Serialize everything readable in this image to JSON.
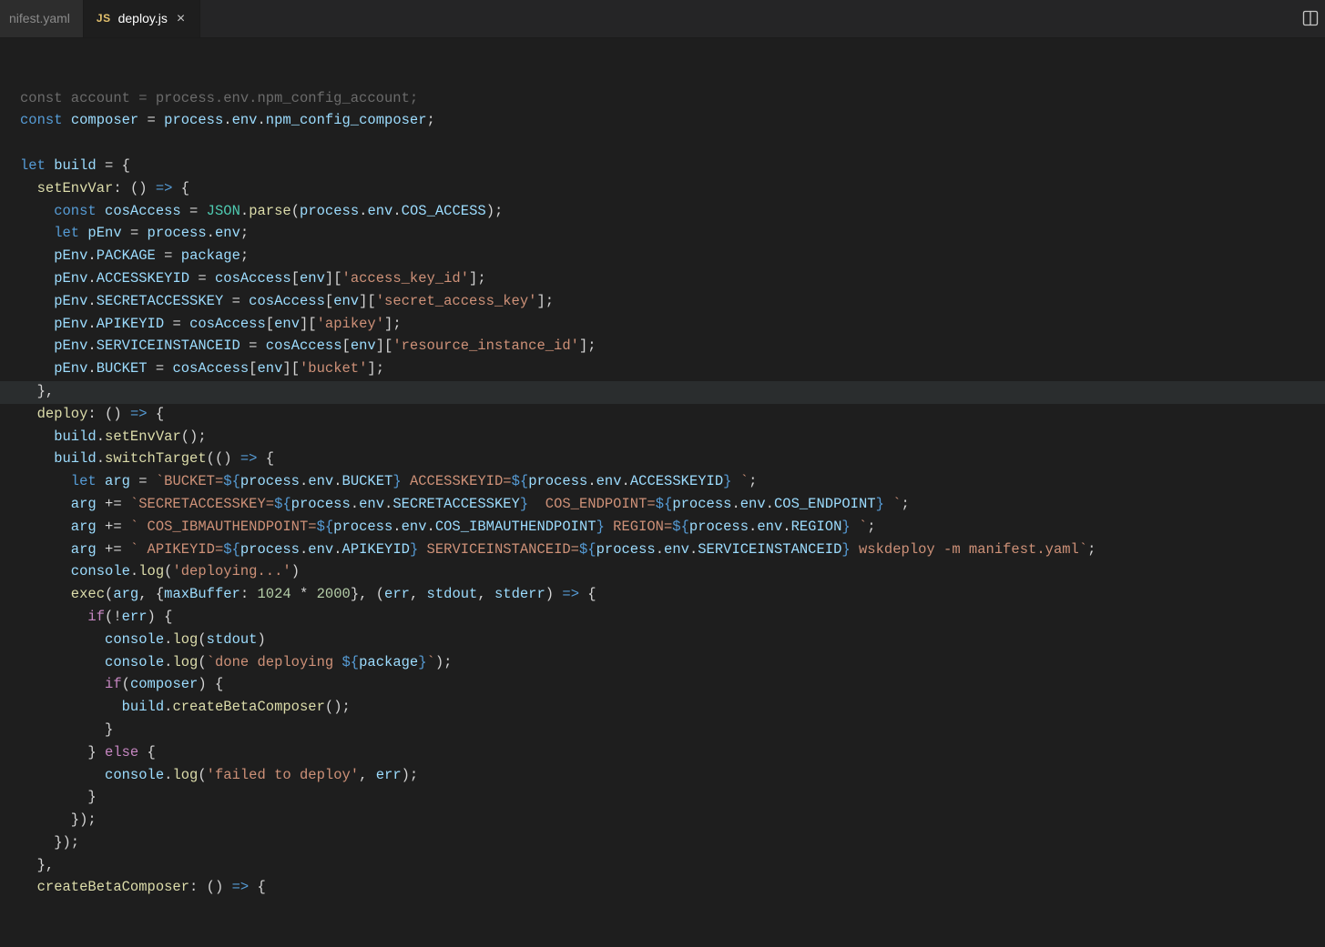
{
  "tabs": {
    "left": {
      "label": "nifest.yaml"
    },
    "active": {
      "icon": "JS",
      "label": "deploy.js"
    }
  },
  "code": {
    "l00": "const account = process.env.npm_config_account;",
    "l01a": "const",
    "l01b": " composer ",
    "l01c": "=",
    "l01d": " process",
    "l01e": ".",
    "l01f": "env",
    "l01g": ".",
    "l01h": "npm_config_composer",
    "l01i": ";",
    "l03a": "let",
    "l03b": " build ",
    "l03c": "=",
    "l03d": " {",
    "l04a": "  setEnvVar",
    "l04b": ":",
    "l04c": " () ",
    "l04d": "=>",
    "l04e": " {",
    "l05a": "    const",
    "l05b": " cosAccess ",
    "l05c": "=",
    "l05d": " JSON",
    "l05e": ".",
    "l05f": "parse",
    "l05g": "(",
    "l05h": "process",
    "l05i": ".",
    "l05j": "env",
    "l05k": ".",
    "l05l": "COS_ACCESS",
    "l05m": ");",
    "l06a": "    let",
    "l06b": " pEnv ",
    "l06c": "=",
    "l06d": " process",
    "l06e": ".",
    "l06f": "env",
    "l06g": ";",
    "l07a": "    pEnv",
    "l07b": ".",
    "l07c": "PACKAGE",
    "l07d": " = ",
    "l07e": "package",
    "l07f": ";",
    "l08a": "    pEnv",
    "l08b": ".",
    "l08c": "ACCESSKEYID",
    "l08d": " = ",
    "l08e": "cosAccess",
    "l08f": "[",
    "l08g": "env",
    "l08h": "][",
    "l08i": "'access_key_id'",
    "l08j": "];",
    "l09a": "    pEnv",
    "l09b": ".",
    "l09c": "SECRETACCESSKEY",
    "l09d": " = ",
    "l09e": "cosAccess",
    "l09f": "[",
    "l09g": "env",
    "l09h": "][",
    "l09i": "'secret_access_key'",
    "l09j": "];",
    "l10a": "    pEnv",
    "l10b": ".",
    "l10c": "APIKEYID",
    "l10d": " = ",
    "l10e": "cosAccess",
    "l10f": "[",
    "l10g": "env",
    "l10h": "][",
    "l10i": "'apikey'",
    "l10j": "];",
    "l11a": "    pEnv",
    "l11b": ".",
    "l11c": "SERVICEINSTANCEID",
    "l11d": " = ",
    "l11e": "cosAccess",
    "l11f": "[",
    "l11g": "env",
    "l11h": "][",
    "l11i": "'resource_instance_id'",
    "l11j": "];",
    "l12a": "    pEnv",
    "l12b": ".",
    "l12c": "BUCKET",
    "l12d": " = ",
    "l12e": "cosAccess",
    "l12f": "[",
    "l12g": "env",
    "l12h": "][",
    "l12i": "'bucket'",
    "l12j": "];",
    "l13": "  },",
    "l14a": "  deploy",
    "l14b": ":",
    "l14c": " () ",
    "l14d": "=>",
    "l14e": " {",
    "l15a": "    build",
    "l15b": ".",
    "l15c": "setEnvVar",
    "l15d": "();",
    "l16a": "    build",
    "l16b": ".",
    "l16c": "switchTarget",
    "l16d": "(() ",
    "l16e": "=>",
    "l16f": " {",
    "l17a": "      let",
    "l17b": " arg ",
    "l17c": "=",
    "l17d": " `BUCKET=",
    "l17e": "${",
    "l17f": "process",
    "l17g": ".",
    "l17h": "env",
    "l17i": ".",
    "l17j": "BUCKET",
    "l17k": "}",
    "l17l": " ACCESSKEYID=",
    "l17m": "${",
    "l17n": "process",
    "l17o": ".",
    "l17p": "env",
    "l17q": ".",
    "l17r": "ACCESSKEYID",
    "l17s": "}",
    "l17t": " `",
    "l17u": ";",
    "l18a": "      arg ",
    "l18b": "+=",
    "l18c": " `SECRETACCESSKEY=",
    "l18d": "${",
    "l18e": "process",
    "l18f": ".",
    "l18g": "env",
    "l18h": ".",
    "l18i": "SECRETACCESSKEY",
    "l18j": "}",
    "l18k": "  COS_ENDPOINT=",
    "l18l": "${",
    "l18m": "process",
    "l18n": ".",
    "l18o": "env",
    "l18p": ".",
    "l18q": "COS_ENDPOINT",
    "l18r": "}",
    "l18s": " `",
    "l18t": ";",
    "l19a": "      arg ",
    "l19b": "+=",
    "l19c": " ` COS_IBMAUTHENDPOINT=",
    "l19d": "${",
    "l19e": "process",
    "l19f": ".",
    "l19g": "env",
    "l19h": ".",
    "l19i": "COS_IBMAUTHENDPOINT",
    "l19j": "}",
    "l19k": " REGION=",
    "l19l": "${",
    "l19m": "process",
    "l19n": ".",
    "l19o": "env",
    "l19p": ".",
    "l19q": "REGION",
    "l19r": "}",
    "l19s": " `",
    "l19t": ";",
    "l20a": "      arg ",
    "l20b": "+=",
    "l20c": " ` APIKEYID=",
    "l20d": "${",
    "l20e": "process",
    "l20f": ".",
    "l20g": "env",
    "l20h": ".",
    "l20i": "APIKEYID",
    "l20j": "}",
    "l20k": " SERVICEINSTANCEID=",
    "l20l": "${",
    "l20m": "process",
    "l20n": ".",
    "l20o": "env",
    "l20p": ".",
    "l20q": "SERVICEINSTANCEID",
    "l20r": "}",
    "l20s": " wskdeploy -m manifest.yaml`",
    "l20t": ";",
    "l21a": "      console",
    "l21b": ".",
    "l21c": "log",
    "l21d": "(",
    "l21e": "'deploying...'",
    "l21f": ")",
    "l22a": "      exec",
    "l22b": "(",
    "l22c": "arg",
    "l22d": ", {",
    "l22e": "maxBuffer",
    "l22f": ":",
    "l22g": " 1024",
    "l22h": " * ",
    "l22i": "2000",
    "l22j": "}, (",
    "l22k": "err",
    "l22l": ", ",
    "l22m": "stdout",
    "l22n": ", ",
    "l22o": "stderr",
    "l22p": ") ",
    "l22q": "=>",
    "l22r": " {",
    "l23a": "        if",
    "l23b": "(!",
    "l23c": "err",
    "l23d": ") {",
    "l24a": "          console",
    "l24b": ".",
    "l24c": "log",
    "l24d": "(",
    "l24e": "stdout",
    "l24f": ")",
    "l25a": "          console",
    "l25b": ".",
    "l25c": "log",
    "l25d": "(",
    "l25e": "`done deploying ",
    "l25f": "${",
    "l25g": "package",
    "l25h": "}",
    "l25i": "`",
    "l25j": ");",
    "l26a": "          if",
    "l26b": "(",
    "l26c": "composer",
    "l26d": ") {",
    "l27a": "            build",
    "l27b": ".",
    "l27c": "createBetaComposer",
    "l27d": "();",
    "l28": "          }",
    "l29a": "        } ",
    "l29b": "else",
    "l29c": " {",
    "l30a": "          console",
    "l30b": ".",
    "l30c": "log",
    "l30d": "(",
    "l30e": "'failed to deploy'",
    "l30f": ", ",
    "l30g": "err",
    "l30h": ");",
    "l31": "        }",
    "l32": "      });",
    "l33": "    });",
    "l34": "  },",
    "l35a": "  createBetaComposer",
    "l35b": ":",
    "l35c": " () ",
    "l35d": "=>",
    "l35e": " {"
  }
}
